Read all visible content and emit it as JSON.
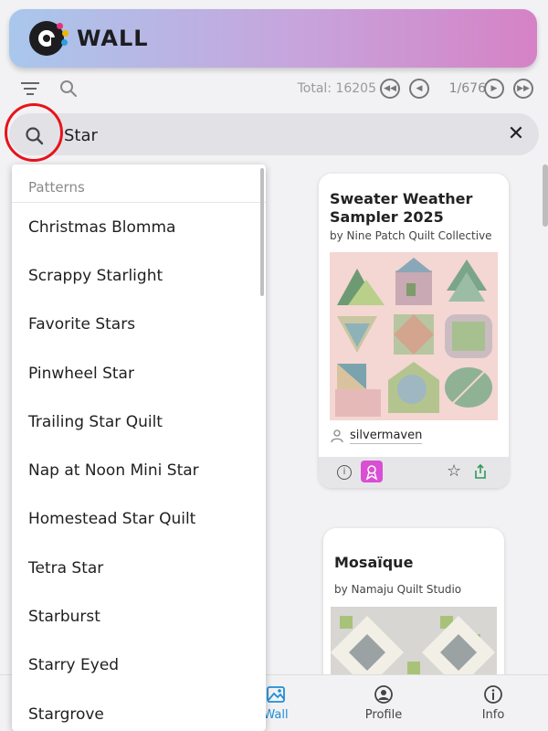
{
  "app": {
    "title": "WALL"
  },
  "toolbar": {
    "total_label": "Total: 16205",
    "page_label": "1/676"
  },
  "search": {
    "value": "Star"
  },
  "dropdown": {
    "header": "Patterns",
    "items": [
      "Christmas Blomma",
      "Scrappy Starlight",
      "Favorite Stars",
      "Pinwheel Star",
      "Trailing Star Quilt",
      "Nap at Noon Mini Star",
      "Homestead Star Quilt",
      "Tetra Star",
      "Starburst",
      "Starry Eyed",
      "Stargrove"
    ]
  },
  "cards": [
    {
      "title": "Sweater Weather Sampler 2025",
      "author": "by Nine Patch Quilt Collective",
      "username": "silvermaven"
    },
    {
      "title": "Mosaïque",
      "author": "by Namaju Quilt Studio"
    }
  ],
  "bottom_nav": {
    "wall": "Wall",
    "profile": "Profile",
    "info": "Info"
  },
  "colors": {
    "accent": "#1e8fd6",
    "highlight_circle": "#e8131a",
    "badge": "#d94fd4"
  }
}
